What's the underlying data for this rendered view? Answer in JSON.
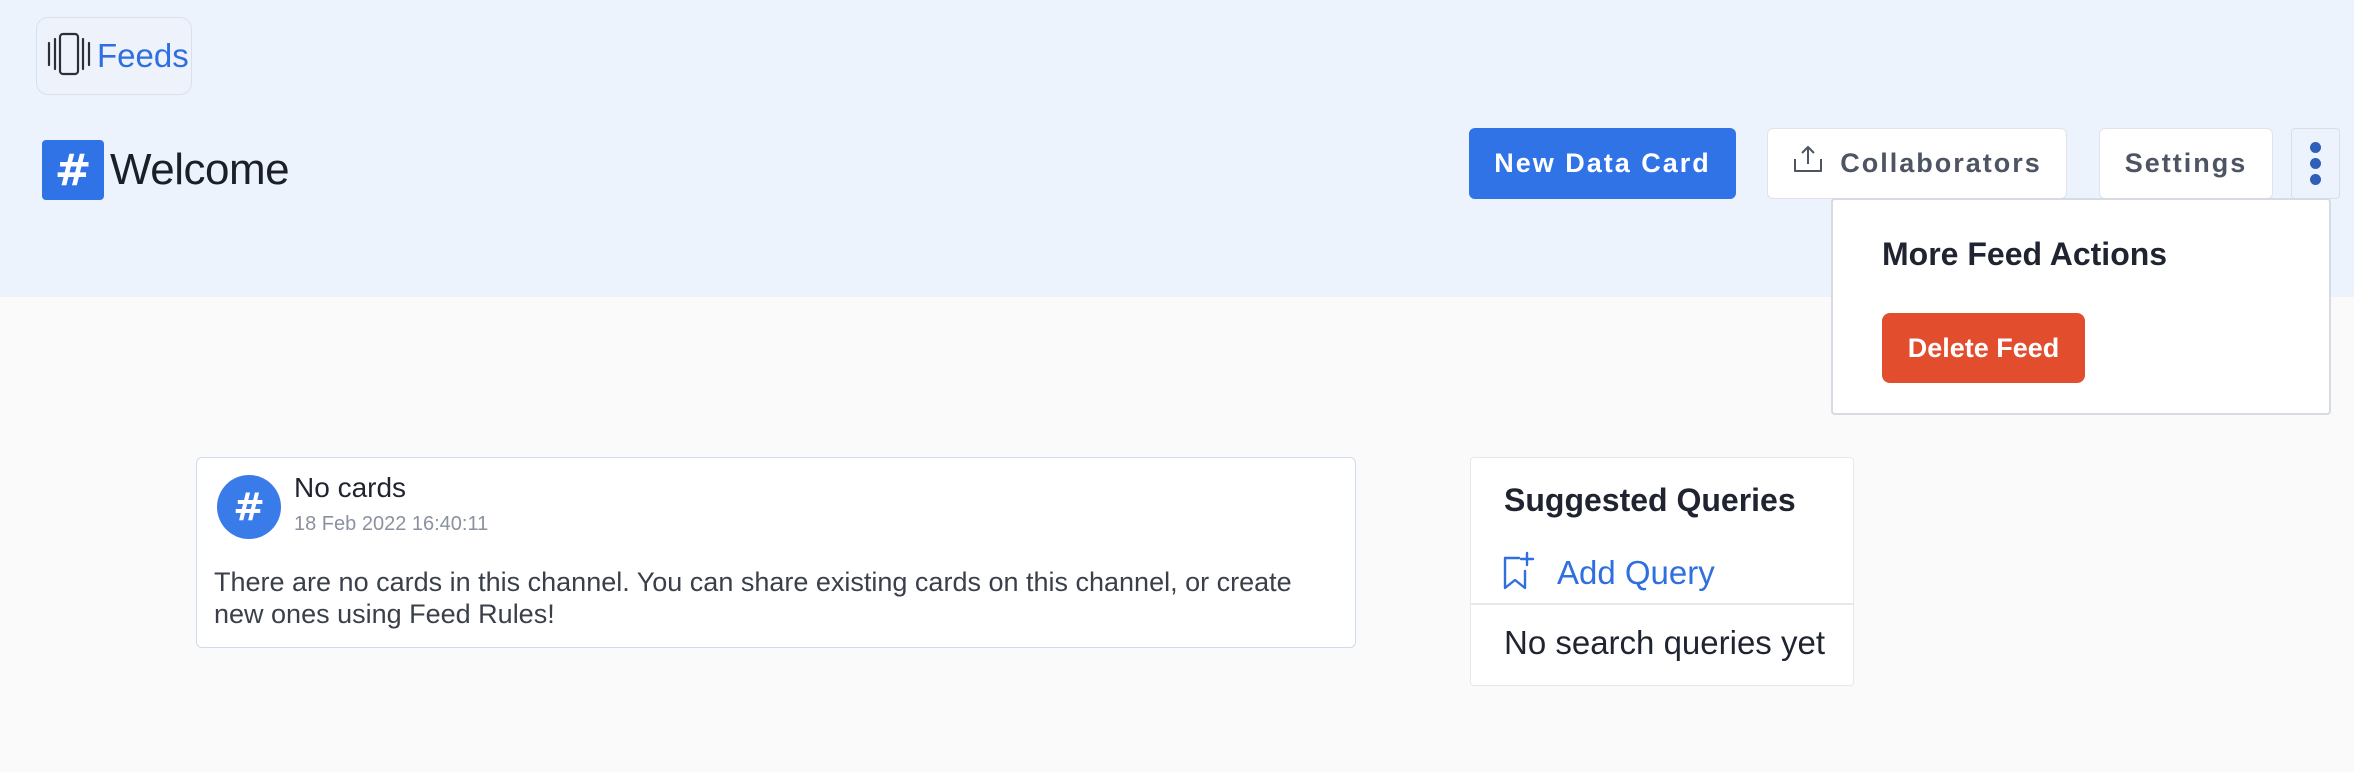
{
  "nav": {
    "feeds_label": "Feeds"
  },
  "feed": {
    "hash_symbol": "#",
    "title": "Welcome"
  },
  "actions": {
    "new_data_card": "New Data Card",
    "collaborators": "Collaborators",
    "settings": "Settings"
  },
  "more_menu": {
    "title": "More Feed Actions",
    "delete_feed": "Delete Feed"
  },
  "card": {
    "avatar_symbol": "#",
    "title": "No cards",
    "timestamp": "18 Feb 2022 16:40:11",
    "body": "There are no cards in this channel. You can share existing cards on this channel, or create new ones using Feed Rules!"
  },
  "suggested_queries": {
    "title": "Suggested Queries",
    "add_query": "Add Query",
    "empty_text": "No search queries yet"
  },
  "colors": {
    "header_bg": "#edf3fd",
    "primary": "#2f73e6",
    "danger": "#e24d2d",
    "link": "#2f6fe0"
  },
  "icons": {
    "feeds": "feeds-icon",
    "collaborators": "upload-share-icon",
    "more": "vertical-dots-icon",
    "add_query": "bookmark-add-icon"
  }
}
